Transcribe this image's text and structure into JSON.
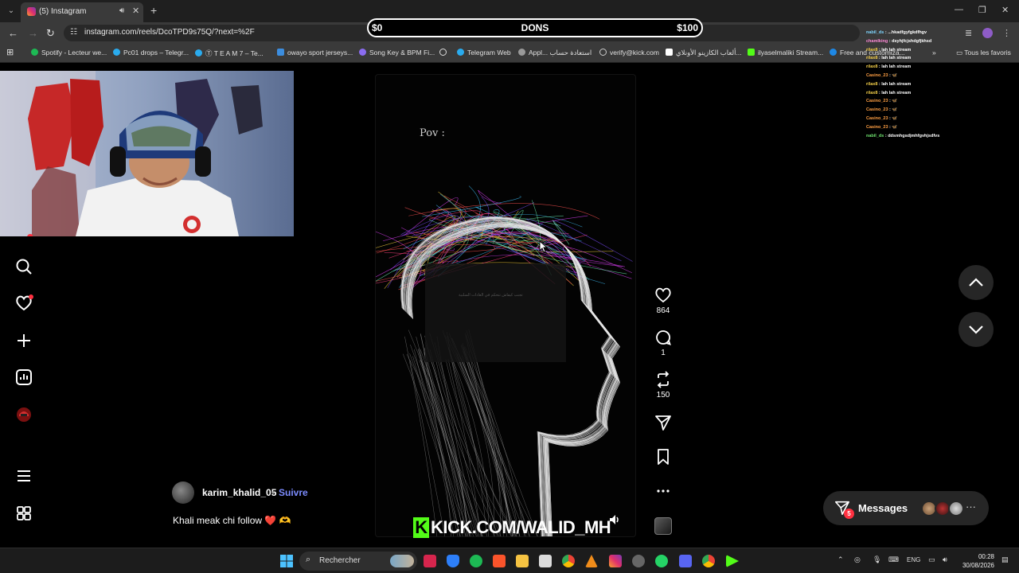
{
  "browser": {
    "tab_title": "(5) Instagram",
    "url": "instagram.com/reels/DcoTPD9s75Q/?next=%2F",
    "bookmarks": [
      {
        "label": "Spotify - Lecteur we...",
        "color": "#1db954"
      },
      {
        "label": "Pc01 drops – Telegr...",
        "color": "#2aabee"
      },
      {
        "label": "Ⓣ T E A M 7 – Te...",
        "color": "#2aabee"
      },
      {
        "label": "owayo sport jerseys...",
        "color": "#3c8dde"
      },
      {
        "label": "Song Key & BPM Fi...",
        "color": "#8a6cf0"
      },
      {
        "label": "",
        "color": "#ddd"
      },
      {
        "label": "Telegram Web",
        "color": "#2aabee"
      },
      {
        "label": "Appl... استعادة حساب",
        "color": "#999"
      },
      {
        "label": "verify@kick.com",
        "color": "#ccc"
      },
      {
        "label": "ألعاب الكازينو الأونلاي...",
        "color": "#fff"
      },
      {
        "label": "ilyaselmaliki Stream...",
        "color": "#53fc18"
      },
      {
        "label": "Free and customiza...",
        "color": "#1e88e5"
      }
    ],
    "all_bookmarks_label": "Tous les favoris"
  },
  "donations": {
    "min": "$0",
    "title": "DONS",
    "max": "$100"
  },
  "chat": [
    {
      "user": "nabil_ds",
      "text": "...hkadfgyfgkdfhgv",
      "color": "#7fd6ff"
    },
    {
      "user": "chamlking",
      "text": "dsyhjfcjshdgfjkhsd",
      "color": "#ff8ad8"
    },
    {
      "user": "rilax8",
      "text": "lah lah stream",
      "color": "#f5d04a"
    },
    {
      "user": "rilax8",
      "text": "lah lah stream",
      "color": "#f5d04a"
    },
    {
      "user": "rilax8",
      "text": "lah lah stream",
      "color": "#f5d04a"
    },
    {
      "user": "Casino_23",
      "text": "🦋",
      "color": "#ff9f43"
    },
    {
      "user": "rilax8",
      "text": "lah lah stream",
      "color": "#f5d04a"
    },
    {
      "user": "rilax8",
      "text": "lah lah stream",
      "color": "#f5d04a"
    },
    {
      "user": "Casino_23",
      "text": "🦋",
      "color": "#ff9f43"
    },
    {
      "user": "Casino_23",
      "text": "🦋",
      "color": "#ff9f43"
    },
    {
      "user": "Casino_23",
      "text": "🦋",
      "color": "#ff9f43"
    },
    {
      "user": "Casino_23",
      "text": "🦋",
      "color": "#ff9f43"
    },
    {
      "user": "nabil_ds",
      "text": "ddsmhgsdjmhfgvhjsdfvs",
      "color": "#6fe36f"
    }
  ],
  "reel": {
    "overlay_title": "Pov :",
    "overlay_faint_text": "تجنب كيفاش تتحكم في العادات السلبية",
    "likes": "864",
    "comments": "1",
    "reposts": "150",
    "author": "karim_khalid_05",
    "separator": "•",
    "follow_label": "Suivre",
    "caption": "Khali meak chi follow ❤️ 🫶"
  },
  "stream_overlay": {
    "kick_label": "KICK.COM/WALID_MH"
  },
  "messages": {
    "label": "Messages",
    "badge": "5",
    "more": "···"
  },
  "taskbar": {
    "search_placeholder": "Rechercher",
    "language": "ENG",
    "time": "00:28",
    "date": "30/08/2026"
  }
}
